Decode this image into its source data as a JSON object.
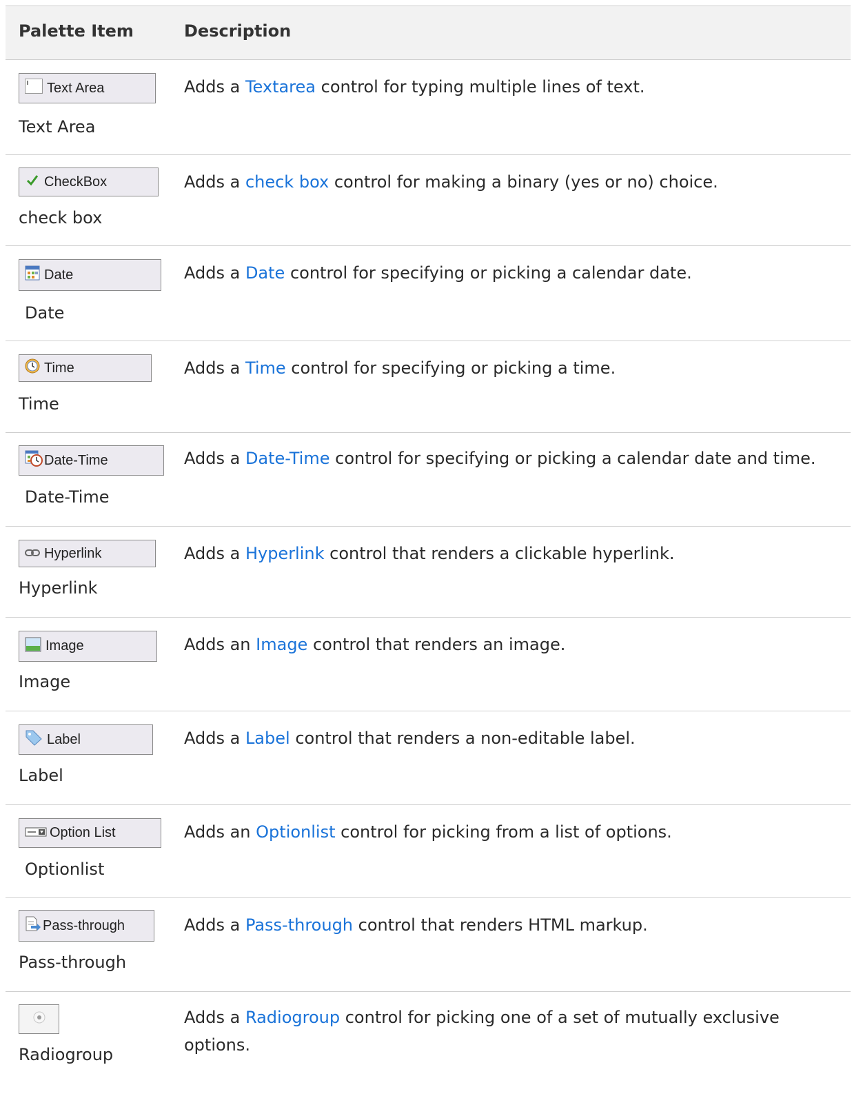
{
  "table": {
    "headers": {
      "palette_item": "Palette Item",
      "description": "Description"
    },
    "rows": [
      {
        "button_label": "Text Area",
        "icon": "textarea-icon",
        "name": "Text Area",
        "desc_pre": "Adds a ",
        "link": "Textarea",
        "desc_post": " control for typing multiple lines of text."
      },
      {
        "button_label": "CheckBox",
        "icon": "checkbox-icon",
        "name": "check box",
        "desc_pre": "Adds a ",
        "link": "check box",
        "desc_post": " control for making a binary (yes or no) choice."
      },
      {
        "button_label": "Date",
        "icon": "calendar-icon",
        "name": "Date",
        "desc_pre": "Adds a ",
        "link": "Date",
        "desc_post": " control for specifying or picking a calendar date."
      },
      {
        "button_label": "Time",
        "icon": "clock-icon",
        "name": "Time",
        "desc_pre": "Adds a ",
        "link": "Time",
        "desc_post": " control for specifying or picking a time."
      },
      {
        "button_label": "Date-Time",
        "icon": "calendar-clock-icon",
        "name": "Date-Time",
        "desc_pre": "Adds a ",
        "link": "Date-Time",
        "desc_post": " control for specifying or picking a calendar date and time."
      },
      {
        "button_label": "Hyperlink",
        "icon": "chain-link-icon",
        "name": "Hyperlink",
        "desc_pre": "Adds a ",
        "link": "Hyperlink",
        "desc_post": " control that renders a clickable hyperlink."
      },
      {
        "button_label": "Image",
        "icon": "picture-icon",
        "name": "Image",
        "desc_pre": "Adds an ",
        "link": "Image",
        "desc_post": " control that renders an image."
      },
      {
        "button_label": "Label",
        "icon": "tag-icon",
        "name": "Label",
        "desc_pre": "Adds a ",
        "link": "Label",
        "desc_post": " control that renders a non-editable label."
      },
      {
        "button_label": "Option List",
        "icon": "dropdown-icon",
        "name": "Optionlist",
        "desc_pre": "Adds an ",
        "link": "Optionlist",
        "desc_post": " control for picking from a list of options."
      },
      {
        "button_label": "Pass-through",
        "icon": "document-arrow-icon",
        "name": "Pass-through",
        "desc_pre": "Adds a ",
        "link": "Pass-through",
        "desc_post": " control that renders HTML markup."
      },
      {
        "button_label": "",
        "icon": "radio-button-icon",
        "name": "Radiogroup",
        "desc_pre": "Adds a ",
        "link": "Radiogroup",
        "desc_post": " control for picking one of a set of mutually exclusive options."
      }
    ]
  },
  "colors": {
    "link": "#1a73d9",
    "header_bg": "#f2f2f2",
    "separator": "#cfcfcf",
    "button_bg": "#eceaf0"
  }
}
